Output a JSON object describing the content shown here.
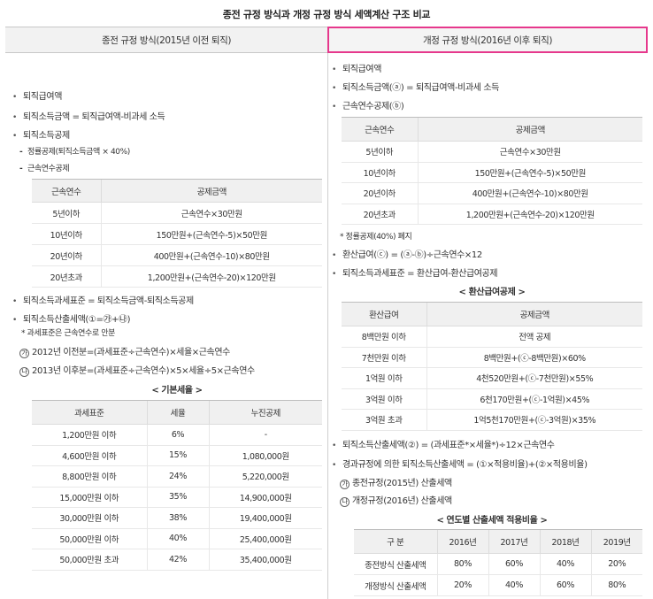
{
  "title": "종전 규정 방식과 개정 규정 방식 세액계산 구조 비교",
  "left": {
    "header": "종전 규정 방식(2015년 이전 퇴직)",
    "items": {
      "b1": "퇴직급여액",
      "b2": "퇴직소득금액 = 퇴직급여액-비과세 소득",
      "b3": "퇴직소득공제",
      "d1": "정률공제(퇴직소득금액 × 40%)",
      "d2": "근속연수공제"
    },
    "table1": {
      "headers": [
        "근속연수",
        "공제금액"
      ],
      "rows": [
        [
          "5년이하",
          "근속연수×30만원"
        ],
        [
          "10년이하",
          "150만원+(근속연수-5)×50만원"
        ],
        [
          "20년이하",
          "400만원+(근속연수-10)×80만원"
        ],
        [
          "20년초과",
          "1,200만원+(근속연수-20)×120만원"
        ]
      ]
    },
    "after": {
      "b4": "퇴직소득과세표준 = 퇴직소득금액-퇴직소득공제",
      "b5": "퇴직소득산출세액(①=㉮+㉯)",
      "note": "* 과세표준은 근속연수로 안분",
      "c1_mark": "가",
      "c1": "2012년 이전분=(과세표준÷근속연수)×세율×근속연수",
      "c2_mark": "나",
      "c2": "2013년 이후분=(과세표준÷근속연수)×5×세율÷5×근속연수"
    },
    "table2_caption": "< 기본세율 >",
    "table2": {
      "headers": [
        "과세표준",
        "세율",
        "누진공제"
      ],
      "rows": [
        [
          "1,200만원 이하",
          "6%",
          "-"
        ],
        [
          "4,600만원 이하",
          "15%",
          "1,080,000원"
        ],
        [
          "8,800만원 이하",
          "24%",
          "5,220,000원"
        ],
        [
          "15,000만원 이하",
          "35%",
          "14,900,000원"
        ],
        [
          "30,000만원 이하",
          "38%",
          "19,400,000원"
        ],
        [
          "50,000만원 이하",
          "40%",
          "25,400,000원"
        ],
        [
          "50,000만원 초과",
          "42%",
          "35,400,000원"
        ]
      ]
    }
  },
  "right": {
    "header": "개정 규정 방식(2016년 이후 퇴직)",
    "items": {
      "b1": "퇴직급여액",
      "b2": "퇴직소득금액(ⓐ) = 퇴직급여액-비과세 소득",
      "b3": "근속연수공제(ⓑ)"
    },
    "table1": {
      "headers": [
        "근속연수",
        "공제금액"
      ],
      "rows": [
        [
          "5년이하",
          "근속연수×30만원"
        ],
        [
          "10년이하",
          "150만원+(근속연수-5)×50만원"
        ],
        [
          "20년이하",
          "400만원+(근속연수-10)×80만원"
        ],
        [
          "20년초과",
          "1,200만원+(근속연수-20)×120만원"
        ]
      ]
    },
    "mid": {
      "note": "* 정률공제(40%) 폐지",
      "b4": "환산급여(ⓒ) = (ⓐ-ⓑ)÷근속연수×12",
      "b5": "퇴직소득과세표준 = 환산급여-환산급여공제"
    },
    "table2_caption": "< 환산급여공제 >",
    "table2": {
      "headers": [
        "환산급여",
        "공제금액"
      ],
      "rows": [
        [
          "8백만원 이하",
          "전액 공제"
        ],
        [
          "7천만원 이하",
          "8백만원+(ⓒ-8백만원)×60%"
        ],
        [
          "1억원 이하",
          "4천520만원+(ⓒ-7천만원)×55%"
        ],
        [
          "3억원 이하",
          "6천170만원+(ⓒ-1억원)×45%"
        ],
        [
          "3억원 초과",
          "1억5천170만원+(ⓒ-3억원)×35%"
        ]
      ]
    },
    "after": {
      "b6": "퇴직소득산출세액(②) = (과세표준*×세율*)÷12×근속연수",
      "b7": "경과규정에 의한 퇴직소득산출세액 = (①×적용비율)+(②×적용비율)",
      "c1_mark": "가",
      "c1": "종전규정(2015년) 산출세액",
      "c2_mark": "나",
      "c2": "개정규정(2016년) 산출세액"
    },
    "table3_caption": "< 연도별 산출세액 적용비율 >",
    "table3": {
      "headers": [
        "구 분",
        "2016년",
        "2017년",
        "2018년",
        "2019년"
      ],
      "rows": [
        [
          "종전방식 산출세액",
          "80%",
          "60%",
          "40%",
          "20%"
        ],
        [
          "개정방식 산출세액",
          "20%",
          "40%",
          "60%",
          "80%"
        ]
      ]
    }
  }
}
